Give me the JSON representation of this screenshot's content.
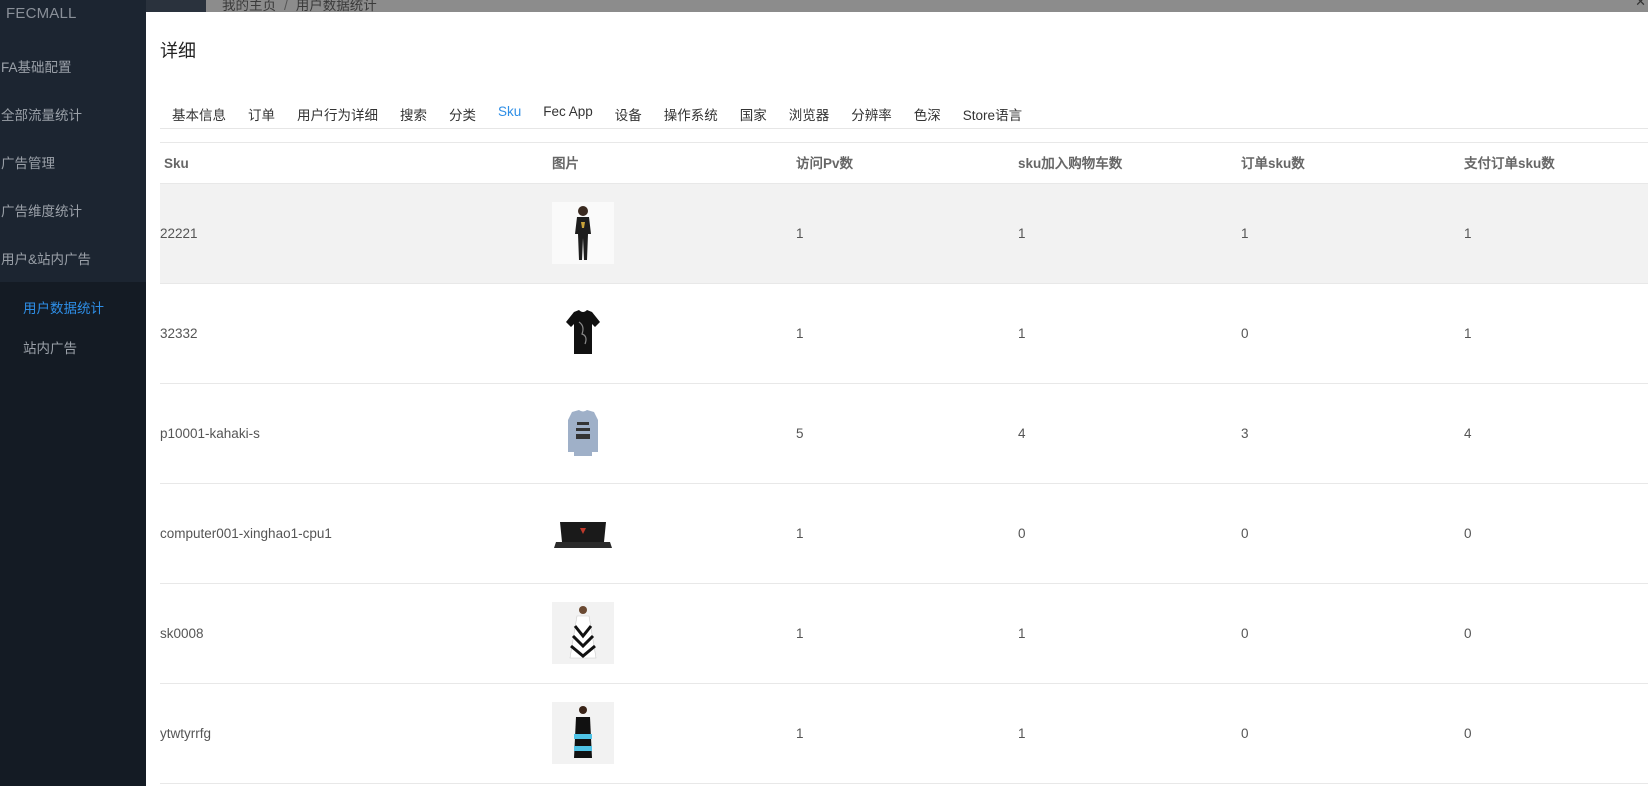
{
  "sidebar": {
    "brand": "FECMALL",
    "items": [
      {
        "label": "FA基础配置"
      },
      {
        "label": "全部流量统计"
      },
      {
        "label": "广告管理"
      },
      {
        "label": "广告维度统计"
      },
      {
        "label": "用户&站内广告"
      }
    ],
    "sub_items": [
      {
        "label": "用户数据统计",
        "active": true
      },
      {
        "label": "站内广告",
        "active": false
      }
    ]
  },
  "breadcrumb": {
    "home": "我的主页",
    "separator": "/",
    "current": "用户数据统计"
  },
  "modal": {
    "title": "详细",
    "tabs": [
      {
        "label": "基本信息"
      },
      {
        "label": "订单"
      },
      {
        "label": "用户行为详细"
      },
      {
        "label": "搜索"
      },
      {
        "label": "分类"
      },
      {
        "label": "Sku",
        "active": true
      },
      {
        "label": "Fec App"
      },
      {
        "label": "设备"
      },
      {
        "label": "操作系统"
      },
      {
        "label": "国家"
      },
      {
        "label": "浏览器"
      },
      {
        "label": "分辨率"
      },
      {
        "label": "色深"
      },
      {
        "label": "Store语言"
      }
    ]
  },
  "table": {
    "headers": {
      "sku": "Sku",
      "image": "图片",
      "pv": "访问Pv数",
      "cart": "sku加入购物车数",
      "order": "订单sku数",
      "paid": "支付订单sku数"
    },
    "rows": [
      {
        "sku": "22221",
        "image_icon": "woman-black-outfit-image",
        "pv": "1",
        "cart": "1",
        "order": "1",
        "paid": "1"
      },
      {
        "sku": "32332",
        "image_icon": "black-tshirt-image",
        "pv": "1",
        "cart": "1",
        "order": "0",
        "paid": "1"
      },
      {
        "sku": "p10001-kahaki-s",
        "image_icon": "grey-sweatshirt-image",
        "pv": "5",
        "cart": "4",
        "order": "3",
        "paid": "4"
      },
      {
        "sku": "computer001-xinghao1-cpu1",
        "image_icon": "laptop-image",
        "pv": "1",
        "cart": "0",
        "order": "0",
        "paid": "0"
      },
      {
        "sku": "sk0008",
        "image_icon": "striped-dress-image",
        "pv": "1",
        "cart": "1",
        "order": "0",
        "paid": "0"
      },
      {
        "sku": "ytwtyrrfg",
        "image_icon": "blue-black-dress-image",
        "pv": "1",
        "cart": "1",
        "order": "0",
        "paid": "0"
      }
    ]
  },
  "colors": {
    "sidebar_bg": "#1c2531",
    "active_link": "#2e8ee6",
    "overlay": "#8c8c8c"
  }
}
